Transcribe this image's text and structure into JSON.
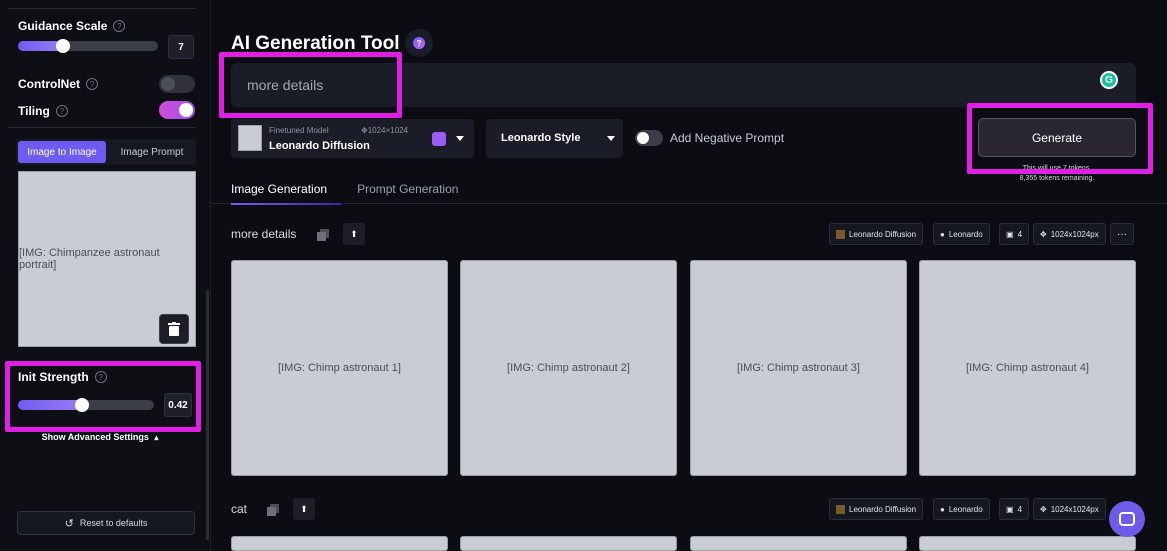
{
  "sidebar": {
    "guidance": {
      "label": "Guidance Scale",
      "value": "7",
      "fraction": 0.32
    },
    "controlnet": {
      "label": "ControlNet",
      "on": false
    },
    "tiling": {
      "label": "Tiling",
      "on": true
    },
    "tabs": [
      "Image to Image",
      "Image Prompt"
    ],
    "init_strength": {
      "label": "Init Strength",
      "value": "0.42",
      "fraction": 0.42
    },
    "advanced_label": "Show Advanced Settings",
    "reset_label": "Reset to defaults"
  },
  "header": {
    "title": "AI Generation Tool"
  },
  "prompt": {
    "value": "more details"
  },
  "model": {
    "caption": "Finetuned Model",
    "resolution": "1024×1024",
    "name": "Leonardo Diffusion"
  },
  "style": {
    "label": "Leonardo Style"
  },
  "negative_prompt": {
    "label": "Add Negative Prompt",
    "on": false
  },
  "generate": {
    "label": "Generate",
    "tokens_line1": "This will use 7 tokens.",
    "tokens_line2": "8,355 tokens remaining."
  },
  "main_tabs": [
    "Image Generation",
    "Prompt Generation"
  ],
  "generations": [
    {
      "prompt": "more details",
      "model": "Leonardo Diffusion",
      "style": "Leonardo",
      "count": "4",
      "size": "1024x1024px",
      "more": "···"
    },
    {
      "prompt": "cat",
      "model": "Leonardo Diffusion",
      "style": "Leonardo",
      "count": "4",
      "size": "1024x1024px"
    }
  ],
  "colors": {
    "accent": "#6e5cf0",
    "highlight": "#e11ee6",
    "chat": "#6c5ce7"
  }
}
